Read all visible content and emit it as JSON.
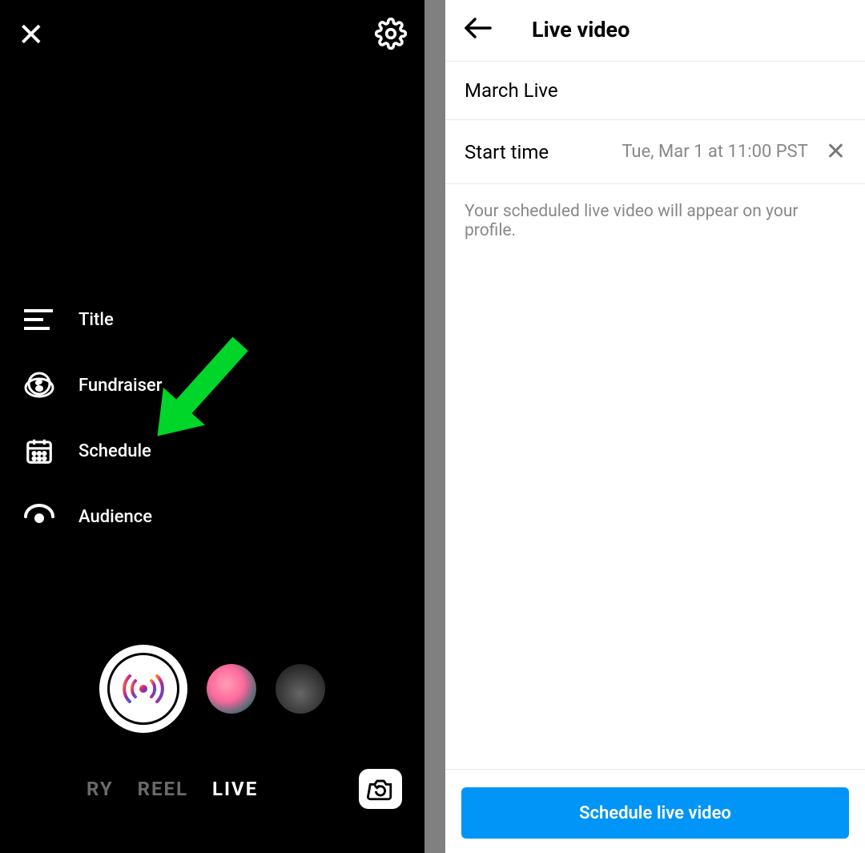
{
  "left": {
    "options": {
      "title": "Title",
      "fundraiser": "Fundraiser",
      "schedule": "Schedule",
      "audience": "Audience"
    },
    "tabs": {
      "story_partial": "RY",
      "reel": "REEL",
      "live": "LIVE"
    }
  },
  "right": {
    "header_title": "Live video",
    "live_title_value": "March Live",
    "start_time_label": "Start time",
    "start_time_value": "Tue, Mar 1 at 11:00 PST",
    "hint": "Your scheduled live video will appear on your profile.",
    "cta": "Schedule live video"
  },
  "colors": {
    "primary_blue": "#0095f6",
    "arrow_green": "#00d52a"
  }
}
